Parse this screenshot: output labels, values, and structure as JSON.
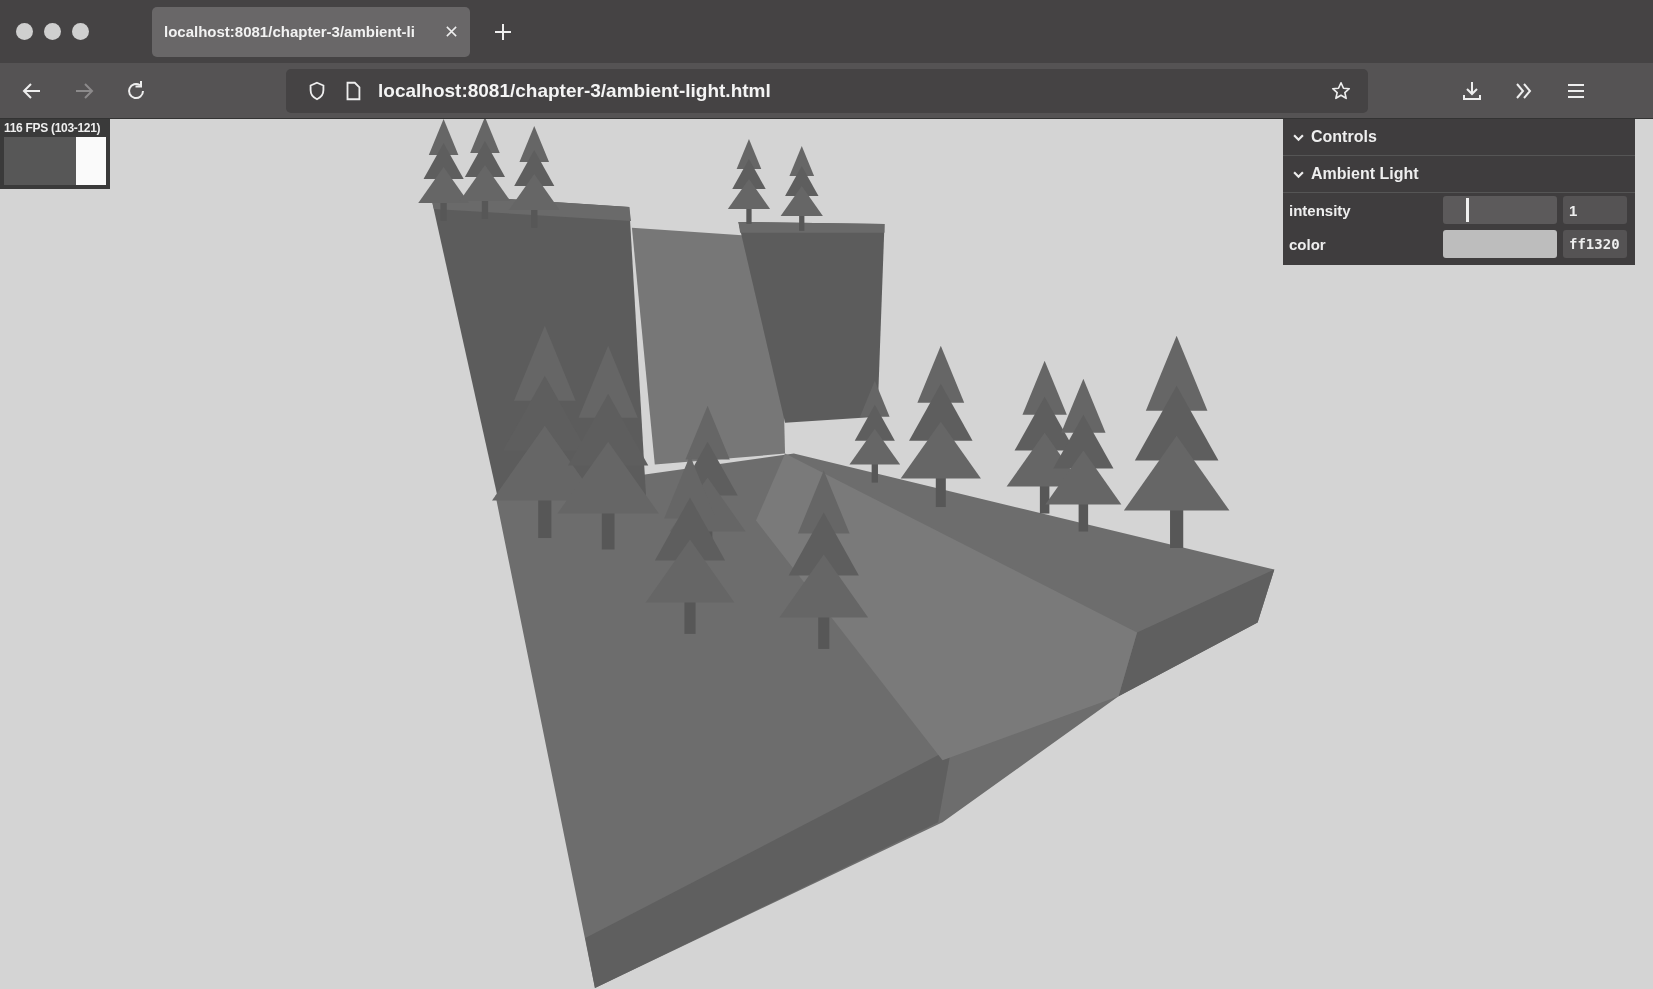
{
  "window": {
    "tabs": [
      {
        "title": "localhost:8081/chapter-3/ambient-li",
        "selected": true
      }
    ],
    "navigation": {
      "back": {
        "disabled": false
      },
      "forward": {
        "disabled": true
      }
    },
    "address_bar": {
      "url": "localhost:8081/chapter-3/ambient-light.html"
    }
  },
  "stats": {
    "fps": "116 FPS (103-121)"
  },
  "gui": {
    "title": "Controls",
    "expanded": true,
    "folders": [
      {
        "title": "Ambient Light",
        "expanded": true,
        "controls": [
          {
            "kind": "slider",
            "label": "intensity",
            "level": 0.2,
            "value": "1"
          },
          {
            "kind": "color",
            "label": "color",
            "value": "ff1320"
          }
        ]
      }
    ]
  }
}
